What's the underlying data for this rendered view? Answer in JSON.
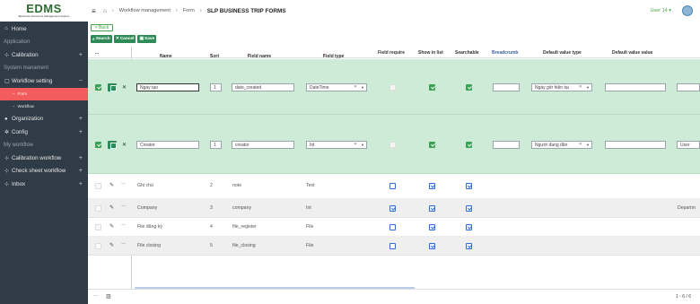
{
  "app": {
    "logo": "EDMS",
    "logo_sub": "Electronic Document Management System"
  },
  "topbar": {
    "crumbs": [
      "Workflow management",
      "Form",
      "SLP BUSINESS TRIP FORMS"
    ],
    "user": "User 14 ▾"
  },
  "sidebar": {
    "items": [
      {
        "label": "Home",
        "icon": "home-icon",
        "type": "item"
      },
      {
        "label": "Application",
        "type": "header"
      },
      {
        "label": "Calibration",
        "icon": "sitemap-icon",
        "type": "item",
        "expand": "+"
      },
      {
        "label": "System manament",
        "type": "header"
      },
      {
        "label": "Workflow setting",
        "icon": "copy-icon",
        "type": "item",
        "expand": "−"
      },
      {
        "label": "Form",
        "type": "sub-active"
      },
      {
        "label": "Workflow",
        "type": "sub"
      },
      {
        "label": "Organization",
        "icon": "user-icon",
        "type": "item",
        "expand": "+"
      },
      {
        "label": "Config",
        "icon": "gear-icon",
        "type": "item",
        "expand": "+"
      },
      {
        "label": "My workflow",
        "type": "header"
      },
      {
        "label": "Calibration workflow",
        "icon": "sitemap-icon",
        "type": "item",
        "expand": "+"
      },
      {
        "label": "Check sheet workflow",
        "icon": "sitemap-icon",
        "type": "item",
        "expand": "+"
      },
      {
        "label": "Inbox",
        "icon": "sitemap-icon",
        "type": "item",
        "expand": "+"
      }
    ]
  },
  "toolbar": {
    "back": "< Back",
    "search": "Search",
    "cancel": "Cancel",
    "save": "Save"
  },
  "columns": {
    "c0": "...",
    "name": "Name",
    "sort": "Sort",
    "field_name": "Field name",
    "field_type": "Field type",
    "field_require": "Field require",
    "show_in_list": "Show in list",
    "searchable": "Searchable",
    "breadcrumb": "Breadcrumb",
    "default_value_type": "Default value type",
    "default_value_value": "Default value value",
    "required_mark": "*"
  },
  "edit_rows": [
    {
      "name": "Ngày tạo",
      "sort": "1",
      "field_name": "date_created",
      "field_type": "DateTime",
      "default_type": "Ngày giờ hiện tại",
      "default_value": "",
      "extra": ""
    },
    {
      "name": "Creator",
      "sort": "1",
      "field_name": "creator",
      "field_type": "Int",
      "default_type": "Người đang đăn",
      "default_value": "",
      "extra": "User"
    }
  ],
  "rows": [
    {
      "name": "Ghi chú",
      "sort": "2",
      "field_name": "note",
      "field_type": "Text",
      "require": false,
      "show": true,
      "search": true,
      "extra": ""
    },
    {
      "name": "Company",
      "sort": "3",
      "field_name": "company",
      "field_type": "Int",
      "require": true,
      "show": true,
      "search": true,
      "extra": "Departm"
    },
    {
      "name": "File đăng ký",
      "sort": "4",
      "field_name": "file_register",
      "field_type": "File",
      "require": false,
      "show": true,
      "search": true,
      "extra": ""
    },
    {
      "name": "File closing",
      "sort": "5",
      "field_name": "file_closing",
      "field_type": "File",
      "require": false,
      "show": true,
      "search": true,
      "extra": ""
    }
  ],
  "footer": {
    "more": "···",
    "columns_icon": "columns-icon",
    "pager": "1 - 6 / 6"
  },
  "colors": {
    "sidebar": "#2f3b46",
    "active": "#f25c5c",
    "green": "#2e8b57",
    "edit_row": "#cdebd7"
  }
}
